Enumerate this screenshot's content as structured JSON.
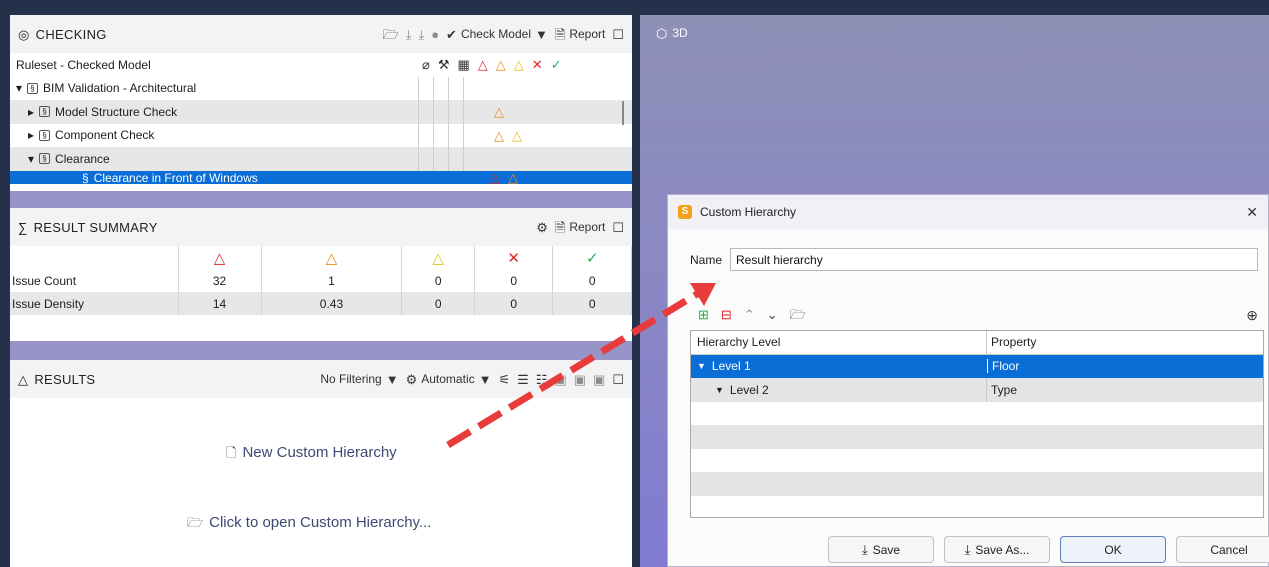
{
  "viewport_3d": {
    "label": "3D"
  },
  "checking": {
    "title": "CHECKING",
    "check_model": "Check Model",
    "report": "Report",
    "header": "Ruleset - Checked Model",
    "rows": [
      {
        "label": "BIM Validation - Architectural",
        "expanded": true
      },
      {
        "label": "Model Structure Check",
        "expanded": false
      },
      {
        "label": "Component Check",
        "expanded": false
      },
      {
        "label": "Clearance",
        "expanded": true
      },
      {
        "label": "Clearance in Front of Windows",
        "selected": true
      }
    ]
  },
  "summary": {
    "title": "RESULT SUMMARY",
    "report": "Report",
    "rows": [
      {
        "label": "Issue Count",
        "values": [
          "32",
          "1",
          "0",
          "0",
          "0"
        ]
      },
      {
        "label": "Issue Density",
        "values": [
          "14",
          "0.43",
          "0",
          "0",
          "0"
        ]
      }
    ]
  },
  "results": {
    "title": "RESULTS",
    "filter": "No Filtering",
    "mode": "Automatic",
    "new_hierarchy": "New Custom Hierarchy",
    "open_hierarchy": "Click to open Custom Hierarchy..."
  },
  "dialog": {
    "title": "Custom Hierarchy",
    "name_label": "Name",
    "name_value": "Result hierarchy",
    "col_level": "Hierarchy Level",
    "col_property": "Property",
    "rows": [
      {
        "level": "Level 1",
        "property": "Floor"
      },
      {
        "level": "Level 2",
        "property": "Type"
      }
    ],
    "buttons": {
      "save": "Save",
      "save_as": "Save As...",
      "ok": "OK",
      "cancel": "Cancel"
    }
  },
  "colors": {
    "selection": "#0b6ed6",
    "critical": "#e0262a",
    "major": "#ee8a1b",
    "minor": "#e9c01e",
    "rejected": "#e0262a",
    "approved": "#26b04a",
    "annotation_arrow": "#e83c3c"
  }
}
